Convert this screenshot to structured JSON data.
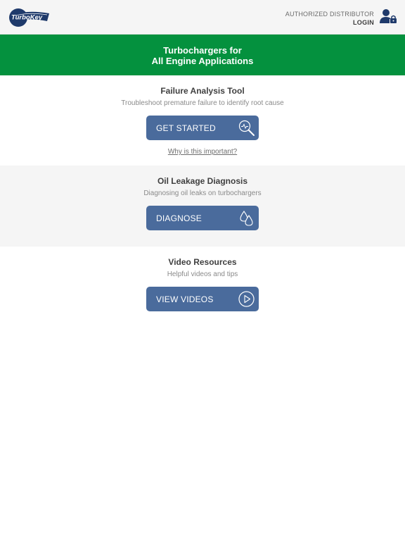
{
  "header": {
    "logo_text": "TurboKey",
    "distributor_label": "AUTHORIZED DISTRIBUTOR",
    "login_label": "LOGIN"
  },
  "banner": {
    "line1": "Turbochargers for",
    "line2": "All Engine Applications"
  },
  "sections": [
    {
      "title": "Failure Analysis Tool",
      "subtitle": "Troubleshoot premature failure to identify root cause",
      "button_label": "GET STARTED",
      "link_label": "Why is this important?"
    },
    {
      "title": "Oil Leakage Diagnosis",
      "subtitle": "Diagnosing oil leaks on turbochargers",
      "button_label": "DIAGNOSE"
    },
    {
      "title": "Video Resources",
      "subtitle": "Helpful videos and tips",
      "button_label": "VIEW VIDEOS"
    }
  ],
  "colors": {
    "brand_green": "#04913e",
    "button_blue": "#4a6b9c",
    "logo_navy": "#1f3a6b"
  }
}
